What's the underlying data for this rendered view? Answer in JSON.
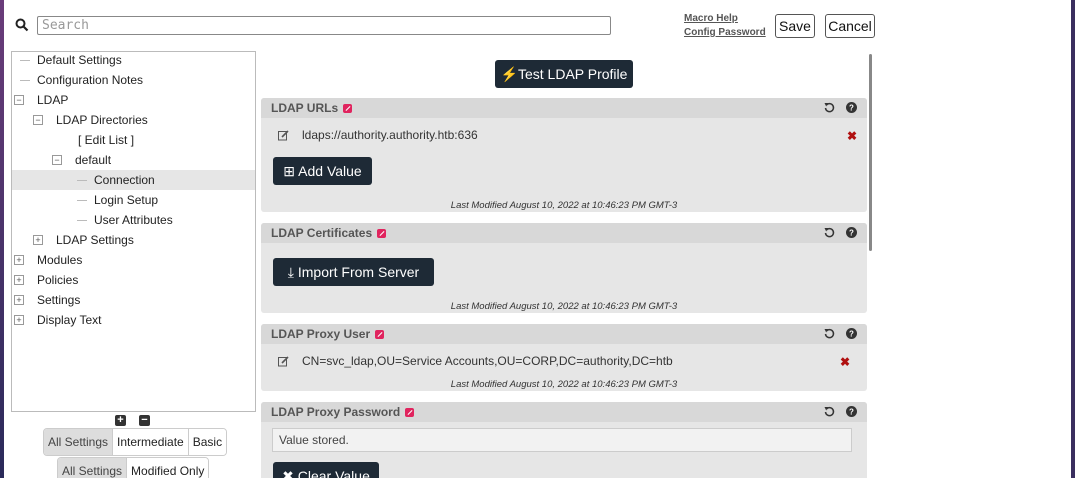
{
  "header": {
    "search_placeholder": "Search",
    "macro_help": "Macro Help",
    "config_password": "Config Password",
    "save_label": "Save",
    "cancel_label": "Cancel"
  },
  "tree": {
    "items": [
      {
        "label": "Default Settings"
      },
      {
        "label": "Configuration Notes"
      },
      {
        "label": "LDAP"
      },
      {
        "label": "LDAP Directories"
      },
      {
        "label": "[ Edit List ]"
      },
      {
        "label": "default"
      },
      {
        "label": "Connection",
        "selected": true
      },
      {
        "label": "Login Setup"
      },
      {
        "label": "User Attributes"
      },
      {
        "label": "LDAP Settings"
      },
      {
        "label": "Modules"
      },
      {
        "label": "Policies"
      },
      {
        "label": "Settings"
      },
      {
        "label": "Display Text"
      }
    ]
  },
  "level_filter": {
    "options": [
      "All Settings",
      "Intermediate",
      "Basic"
    ],
    "selected": "All Settings"
  },
  "modified_filter": {
    "options": [
      "All Settings",
      "Modified Only"
    ],
    "selected": "All Settings"
  },
  "main": {
    "test_button": "Test LDAP Profile",
    "sections": [
      {
        "title": "LDAP URLs",
        "value": "ldaps://authority.authority.htb:636",
        "button": "Add Value",
        "modified": "Last Modified August 10, 2022 at 10:46:23 PM GMT-3"
      },
      {
        "title": "LDAP Certificates",
        "button": "Import From Server",
        "modified": "Last Modified August 10, 2022 at 10:46:23 PM GMT-3"
      },
      {
        "title": "LDAP Proxy User",
        "value": "CN=svc_ldap,OU=Service Accounts,OU=CORP,DC=authority,DC=htb",
        "modified": "Last Modified August 10, 2022 at 10:46:23 PM GMT-3"
      },
      {
        "title": "LDAP Proxy Password",
        "value": "Value stored.",
        "button": "Clear Value"
      }
    ]
  },
  "colors": {
    "accent": "#e0245e",
    "dark_button": "#1e2a36",
    "delete": "#b01010"
  }
}
